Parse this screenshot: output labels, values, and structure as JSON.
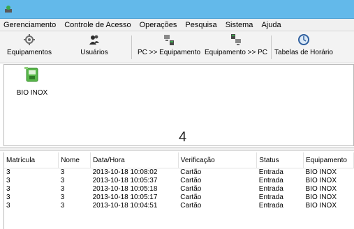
{
  "menu": {
    "items": [
      "Gerenciamento",
      "Controle de Acesso",
      "Operações",
      "Pesquisa",
      "Sistema",
      "Ajuda"
    ]
  },
  "toolbar": {
    "equipamentos": "Equipamentos",
    "usuarios": "Usuários",
    "pc_to_equipamento": "PC >> Equipamento",
    "equipamento_to_pc": "Equipamento >> PC",
    "tabelas_horario": "Tabelas de Horário"
  },
  "devices": [
    {
      "name": "BIO INOX"
    }
  ],
  "device_count": "4",
  "table": {
    "columns": [
      "Matrícula",
      "Nome",
      "Data/Hora",
      "Verificação",
      "Status",
      "Equipamento"
    ],
    "rows": [
      [
        "3",
        "3",
        "2013-10-18 10:08:02",
        "Cartão",
        "Entrada",
        "BIO INOX"
      ],
      [
        "3",
        "3",
        "2013-10-18 10:05:37",
        "Cartão",
        "Entrada",
        "BIO INOX"
      ],
      [
        "3",
        "3",
        "2013-10-18 10:05:18",
        "Cartão",
        "Entrada",
        "BIO INOX"
      ],
      [
        "3",
        "3",
        "2013-10-18 10:05:17",
        "Cartão",
        "Entrada",
        "BIO INOX"
      ],
      [
        "3",
        "3",
        "2013-10-18 10:04:51",
        "Cartão",
        "Entrada",
        "BIO INOX"
      ]
    ]
  },
  "colors": {
    "titlebar": "#63b9ea",
    "menubar": "#f0f0f0",
    "toolbar": "#f3f3f3"
  }
}
